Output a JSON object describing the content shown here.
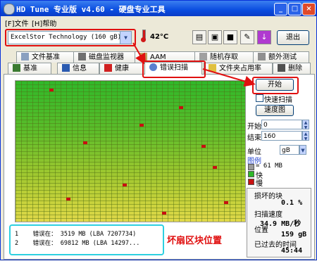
{
  "window": {
    "title": "HD Tune  专业版 v4.60 - 硬盘专业工具"
  },
  "menu": {
    "file": "[F]文件",
    "help": "[H]帮助"
  },
  "toolbar": {
    "drive": "ExcelStor Technology     (160 gB)",
    "temperature": "42°C",
    "exit_label": "退出"
  },
  "tabs_row1": [
    "文件基准",
    "磁盘监视器",
    "AAM",
    "随机存取",
    "额外测试"
  ],
  "tabs_row2": [
    "基准",
    "信息",
    "健康",
    "错误扫描",
    "文件夹占用率",
    "删除"
  ],
  "controls": {
    "start_button": "开始",
    "quick_scan": "快速扫描",
    "speed_map_button": "速度图",
    "start_label": "开始",
    "start_value": "0",
    "end_label": "结束",
    "end_value": "160",
    "unit_label": "单位",
    "unit_value": "gB"
  },
  "legend": {
    "title": "图例",
    "block_size": "= 61 MB",
    "ok": "快",
    "bad": "慢"
  },
  "stats": {
    "damaged_label": "损坏的块",
    "damaged_value": "0.1 %",
    "speed_label": "扫描速度",
    "speed_value": "34.9 MB/秒",
    "position_label": "位置",
    "position_value": "159 gB",
    "elapsed_label": "已过去的时间",
    "elapsed_value": "45:44"
  },
  "errors": [
    {
      "num": "1",
      "text": "错误在：  3519 MB (LBA 7207734)"
    },
    {
      "num": "2",
      "text": "错误在： 69812 MB (LBA 14297..."
    }
  ],
  "annotation": "坏扇区块位置",
  "colors": {
    "ok": "#2fb82a",
    "bad": "#c81010",
    "highlight": "#e01010",
    "list_border": "#2ed0e0"
  }
}
